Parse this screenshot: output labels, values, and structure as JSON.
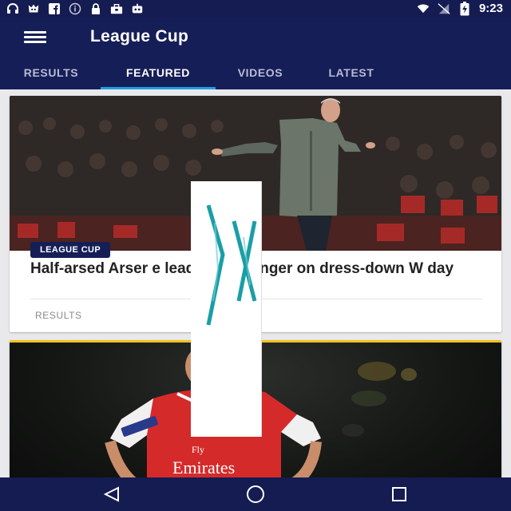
{
  "status_bar": {
    "time": "9:23",
    "left_icons": [
      "headset-icon",
      "game-mascot-icon",
      "facebook-icon",
      "info-icon",
      "lock-icon",
      "briefcase-icon",
      "robot-icon"
    ],
    "right_icons": [
      "wifi-icon",
      "no-sim-icon",
      "battery-charging-icon"
    ]
  },
  "app_bar": {
    "title": "League Cup",
    "menu_icon": "hamburger-menu-icon"
  },
  "tabs": [
    {
      "label": "RESULTS",
      "active": false
    },
    {
      "label": "FEATURED",
      "active": true
    },
    {
      "label": "VIDEOS",
      "active": false
    },
    {
      "label": "LATEST",
      "active": false
    }
  ],
  "articles": [
    {
      "badge": "LEAGUE CUP",
      "headline": "Half-arsed Arser      e lead from Wenger on dress-down W        day",
      "category": "RESULTS",
      "photo_icon": "manager-gesturing-photo"
    },
    {
      "photo_icon": "player-emirates-shirt-photo",
      "shirt_text": "Fly Emirates"
    }
  ],
  "nav_bar": {
    "buttons": [
      "back-triangle-icon",
      "home-circle-icon",
      "recents-square-icon"
    ]
  },
  "colors": {
    "primary": "#161e57",
    "tab_indicator": "#1ea0e6",
    "accent_yellow": "#f2c21b",
    "shirt_red": "#d52a2a"
  }
}
